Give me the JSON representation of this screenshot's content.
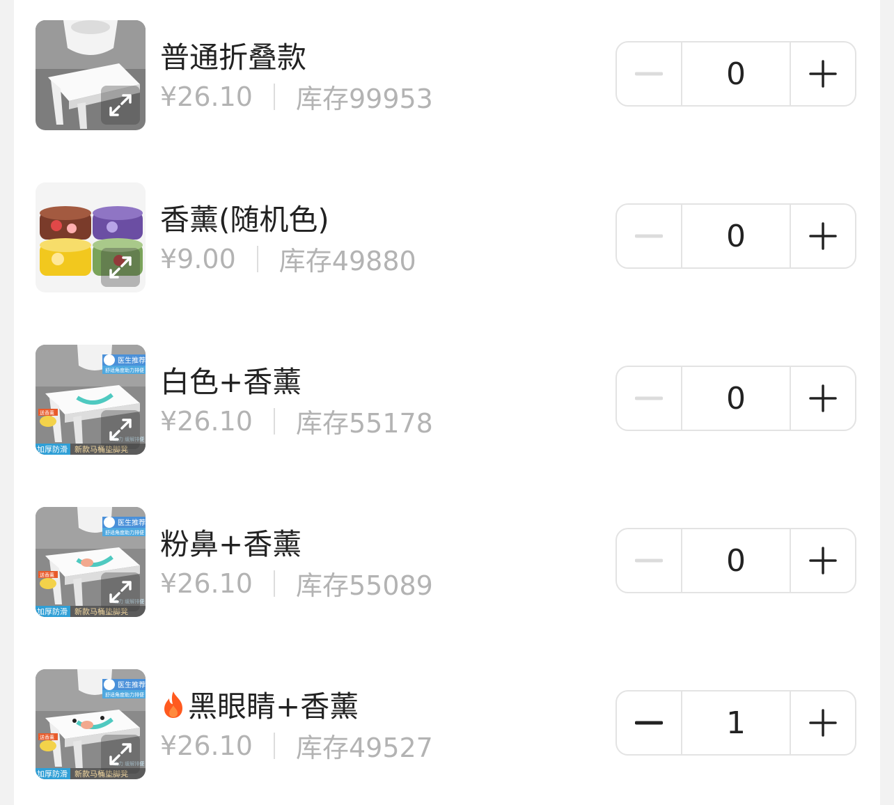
{
  "colors": {
    "text_primary": "#222222",
    "text_secondary": "#b3b3b3",
    "border": "#e3e3e3",
    "minus_disabled": "#dcdcdc",
    "minus_enabled": "#222222",
    "fire": "#ff5a1f"
  },
  "items": [
    {
      "name": "普通折叠款",
      "hot": false,
      "price": "¥26.10",
      "stock": "库存99953",
      "quantity": "0",
      "minus_enabled": false,
      "image": "white-folding-stool-photo"
    },
    {
      "name": "香薰(随机色)",
      "hot": false,
      "price": "¥9.00",
      "stock": "库存49880",
      "quantity": "0",
      "minus_enabled": false,
      "image": "air-freshener-cans-photo"
    },
    {
      "name": "白色+香薰",
      "hot": false,
      "price": "¥26.10",
      "stock": "库存55178",
      "quantity": "0",
      "minus_enabled": false,
      "image": "white-stool-photo",
      "image_texts": [
        "医生推荐",
        "舒适角度助力排便",
        "送香薰",
        "加厚防滑",
        "新款马桶垫脚凳",
        "助力 缓解排便"
      ]
    },
    {
      "name": "粉鼻+香薰",
      "hot": false,
      "price": "¥26.10",
      "stock": "库存55089",
      "quantity": "0",
      "minus_enabled": false,
      "image": "pink-nose-stool-photo",
      "image_texts": [
        "医生推荐",
        "舒适角度助力排便",
        "送香薰",
        "加厚防滑",
        "新款马桶垫脚凳",
        "助力 缓解排便"
      ]
    },
    {
      "name": "黑眼睛+香薰",
      "hot": true,
      "price": "¥26.10",
      "stock": "库存49527",
      "quantity": "1",
      "minus_enabled": true,
      "image": "black-eyes-stool-photo",
      "image_texts": [
        "医生推荐",
        "舒适角度助力排便",
        "送香薰",
        "加厚防滑",
        "新款马桶垫脚凳",
        "助力 缓解排便"
      ]
    }
  ]
}
